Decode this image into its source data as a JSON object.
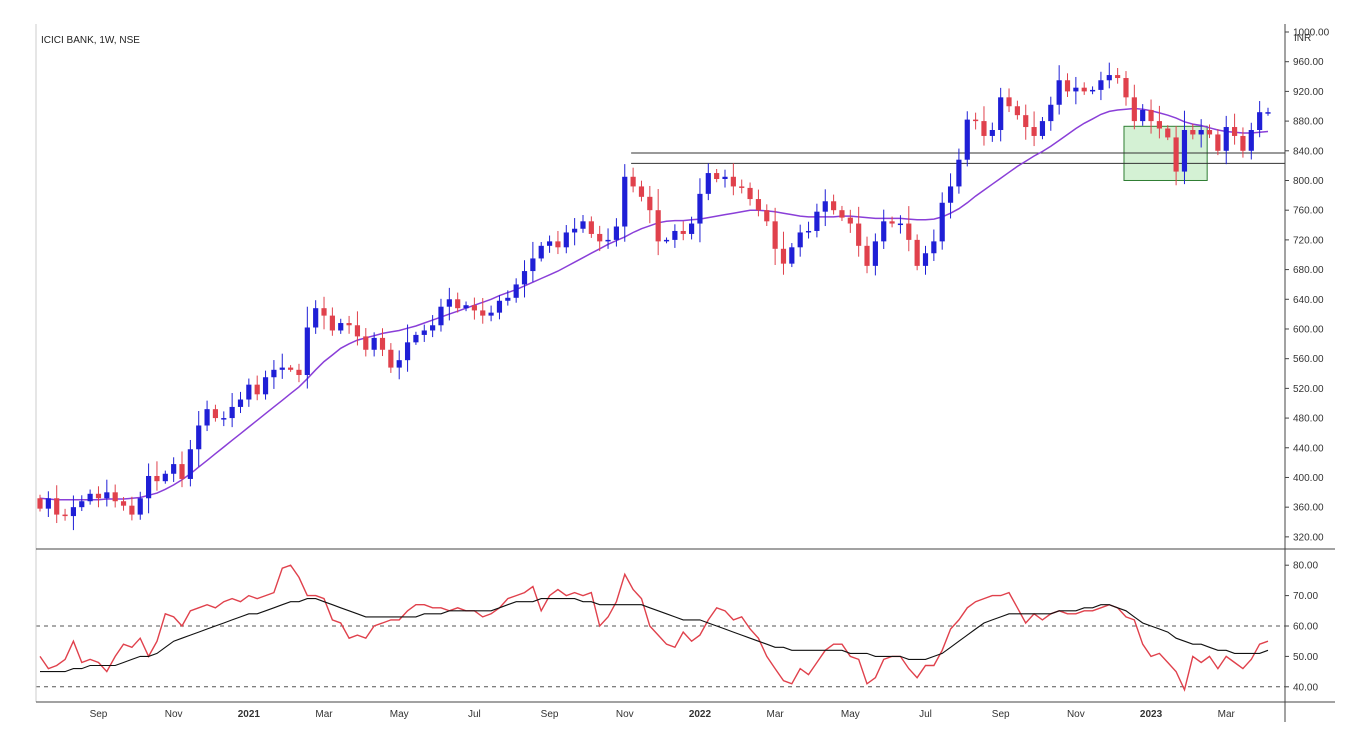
{
  "header": {
    "title": "ICICI BANK, 1W, NSE",
    "currency": "INR"
  },
  "colors": {
    "up": "#1f1fd6",
    "down": "#e0414c",
    "ma": "#8a3fd8",
    "rsi": "#e0414c",
    "rsi_ma": "#111111",
    "levels": "#333333",
    "zone_fill": "#c6ecc6",
    "zone_stroke": "#2e7d32"
  },
  "chart_data": [
    {
      "type": "candlestick",
      "title": "ICICI BANK, 1W, NSE",
      "ylabel": "INR",
      "ylim": [
        305,
        1000
      ],
      "yticks": [
        "320.00",
        "360.00",
        "400.00",
        "440.00",
        "480.00",
        "520.00",
        "560.00",
        "600.00",
        "640.00",
        "680.00",
        "720.00",
        "760.00",
        "800.00",
        "840.00",
        "880.00",
        "920.00",
        "960.00",
        "1000.00"
      ],
      "xticks": [
        {
          "label": "Sep",
          "week": 7
        },
        {
          "label": "Nov",
          "week": 16
        },
        {
          "label": "2021",
          "week": 25
        },
        {
          "label": "Mar",
          "week": 34
        },
        {
          "label": "May",
          "week": 43
        },
        {
          "label": "Jul",
          "week": 52
        },
        {
          "label": "Sep",
          "week": 61
        },
        {
          "label": "Nov",
          "week": 70
        },
        {
          "label": "2022",
          "week": 79
        },
        {
          "label": "Mar",
          "week": 88
        },
        {
          "label": "May",
          "week": 97
        },
        {
          "label": "Jul",
          "week": 106
        },
        {
          "label": "Sep",
          "week": 115
        },
        {
          "label": "Nov",
          "week": 124
        },
        {
          "label": "2023",
          "week": 133
        },
        {
          "label": "Mar",
          "week": 142
        }
      ],
      "close": [
        358,
        372,
        350,
        348,
        360,
        368,
        378,
        372,
        380,
        368,
        362,
        350,
        372,
        402,
        395,
        405,
        418,
        398,
        438,
        470,
        492,
        480,
        480,
        495,
        505,
        525,
        512,
        535,
        545,
        548,
        545,
        538,
        602,
        628,
        618,
        598,
        608,
        605,
        590,
        572,
        588,
        572,
        548,
        558,
        582,
        592,
        598,
        605,
        630,
        640,
        628,
        632,
        625,
        618,
        622,
        638,
        642,
        660,
        678,
        695,
        712,
        718,
        710,
        730,
        735,
        745,
        728,
        718,
        720,
        738,
        805,
        792,
        778,
        760,
        718,
        720,
        732,
        728,
        742,
        782,
        810,
        802,
        805,
        792,
        790,
        775,
        760,
        745,
        708,
        688,
        710,
        730,
        732,
        758,
        772,
        760,
        750,
        742,
        712,
        685,
        718,
        745,
        742,
        742,
        720,
        685,
        702,
        718,
        770,
        792,
        828,
        882,
        880,
        860,
        868,
        912,
        900,
        888,
        872,
        860,
        880,
        902,
        935,
        920,
        925,
        920,
        922,
        935,
        942,
        938,
        912,
        880,
        895,
        880,
        870,
        858,
        812,
        868,
        862,
        868,
        862,
        840,
        872,
        860,
        840,
        868,
        892,
        892
      ],
      "ma": [
        372,
        371,
        370,
        370,
        370,
        370,
        370,
        370,
        371,
        371,
        371,
        372,
        373,
        376,
        379,
        384,
        390,
        397,
        405,
        414,
        423,
        432,
        441,
        450,
        459,
        468,
        477,
        486,
        495,
        504,
        513,
        522,
        533,
        545,
        556,
        565,
        574,
        580,
        585,
        588,
        591,
        594,
        596,
        598,
        601,
        604,
        608,
        612,
        616,
        620,
        624,
        628,
        632,
        636,
        640,
        645,
        649,
        653,
        658,
        663,
        668,
        673,
        678,
        684,
        690,
        696,
        702,
        708,
        714,
        719,
        724,
        730,
        735,
        739,
        743,
        745,
        746,
        746,
        747,
        748,
        750,
        752,
        754,
        756,
        758,
        760,
        760,
        759,
        758,
        756,
        754,
        752,
        751,
        751,
        751,
        751,
        752,
        752,
        751,
        750,
        749,
        749,
        749,
        749,
        748,
        747,
        747,
        748,
        751,
        756,
        762,
        770,
        779,
        787,
        795,
        803,
        811,
        819,
        826,
        833,
        839,
        846,
        854,
        862,
        870,
        877,
        883,
        889,
        893,
        895,
        896,
        897,
        896,
        894,
        891,
        888,
        884,
        879,
        876,
        874,
        871,
        868,
        866,
        865,
        864,
        864,
        865,
        866
      ],
      "candles_note": "OHLC derived from close series",
      "levels": [
        837,
        823
      ],
      "zone": {
        "week_start": 130,
        "week_end": 139,
        "low": 800,
        "high": 873
      }
    },
    {
      "type": "line",
      "title": "",
      "ylim": [
        35,
        85
      ],
      "yticks": [
        "40.00",
        "50.00",
        "60.00",
        "70.00",
        "80.00"
      ],
      "dashed_levels": [
        60,
        40
      ],
      "series": [
        {
          "values": [
            50,
            46,
            47,
            49,
            55,
            48,
            49,
            48,
            45,
            50,
            54,
            53,
            56,
            50,
            55,
            64,
            63,
            60,
            65,
            66,
            67,
            66,
            68,
            69,
            68,
            70,
            69,
            70,
            71,
            79,
            80,
            76,
            70,
            70,
            69,
            62,
            61,
            56,
            57,
            56,
            60,
            61,
            62,
            62,
            65,
            67,
            67,
            66,
            66,
            65,
            66,
            65,
            65,
            63,
            64,
            66,
            69,
            70,
            71,
            73,
            65,
            70,
            72,
            70,
            71,
            70,
            71,
            60,
            63,
            68,
            77,
            72,
            69,
            60,
            57,
            54,
            53,
            58,
            55,
            57,
            62,
            66,
            65,
            62,
            63,
            59,
            56,
            50,
            46,
            42,
            41,
            46,
            44,
            48,
            52,
            54,
            54,
            50,
            49,
            41,
            43,
            49,
            50,
            50,
            46,
            43,
            47,
            47,
            52,
            59,
            62,
            66,
            68,
            69,
            70,
            70,
            71,
            66,
            61,
            64,
            62,
            64,
            65,
            64,
            64,
            65,
            65,
            66,
            67,
            66,
            63,
            62,
            54,
            50,
            51,
            48,
            45,
            39,
            50,
            48,
            50,
            46,
            50,
            48,
            46,
            49,
            54,
            55
          ]
        },
        {
          "values": [
            45,
            45,
            45,
            45,
            46,
            46,
            47,
            47,
            47,
            47,
            48,
            49,
            50,
            50,
            51,
            53,
            55,
            56,
            57,
            58,
            59,
            60,
            61,
            62,
            63,
            64,
            64,
            65,
            66,
            67,
            68,
            68,
            69,
            69,
            68,
            67,
            66,
            65,
            64,
            63,
            63,
            63,
            63,
            63,
            63,
            63,
            64,
            64,
            64,
            65,
            65,
            65,
            65,
            65,
            65,
            66,
            67,
            68,
            68,
            68,
            69,
            69,
            69,
            69,
            69,
            68,
            68,
            67,
            67,
            67,
            67,
            67,
            67,
            66,
            65,
            64,
            63,
            62,
            62,
            62,
            61,
            60,
            59,
            58,
            57,
            56,
            55,
            54,
            53,
            53,
            52,
            52,
            52,
            52,
            52,
            52,
            52,
            51,
            51,
            51,
            50,
            50,
            50,
            50,
            49,
            49,
            49,
            50,
            51,
            53,
            55,
            57,
            59,
            61,
            62,
            63,
            64,
            64,
            64,
            64,
            64,
            64,
            65,
            65,
            65,
            66,
            66,
            67,
            67,
            66,
            65,
            63,
            61,
            60,
            59,
            58,
            56,
            55,
            54,
            54,
            53,
            52,
            52,
            51,
            51,
            51,
            51,
            52
          ]
        }
      ]
    }
  ]
}
